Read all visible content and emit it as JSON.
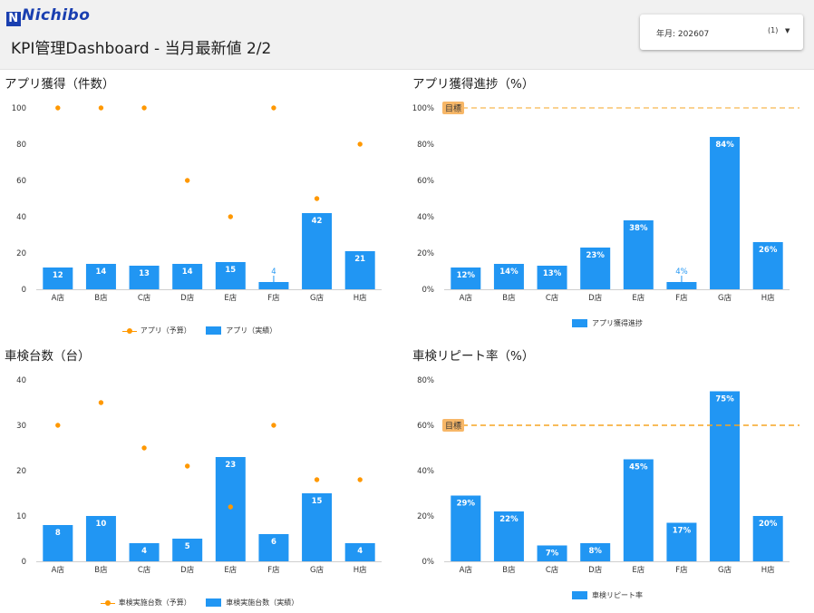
{
  "header": {
    "logo_text": "Nichibo",
    "title": "KPI管理Dashboard - 当月最新値 2/2",
    "filter_label": "年月: 202607",
    "filter_count": "(1)",
    "filter_arrow": "▼"
  },
  "colors": {
    "bar": "#2196f3",
    "budget": "#ff9800",
    "target_line": "#f5a623",
    "target_label_bg": "#f7b768"
  },
  "chart_data": [
    {
      "title": "アプリ獲得（件数）",
      "type": "bar",
      "categories": [
        "A店",
        "B店",
        "C店",
        "D店",
        "E店",
        "F店",
        "G店",
        "H店"
      ],
      "ylim": [
        0,
        100
      ],
      "yticks": [
        "0",
        "20",
        "40",
        "60",
        "80",
        "100"
      ],
      "series": [
        {
          "name": "アプリ（予算）",
          "type": "scatter",
          "values": [
            100,
            100,
            100,
            60,
            40,
            100,
            50,
            80
          ]
        },
        {
          "name": "アプリ（実績）",
          "type": "bar",
          "values": [
            12,
            14,
            13,
            14,
            15,
            4,
            42,
            21
          ],
          "labels": [
            "12",
            "14",
            "13",
            "14",
            "15",
            "4",
            "42",
            "21"
          ]
        }
      ],
      "legend": "bottom"
    },
    {
      "title": "アプリ獲得進捗（%）",
      "type": "bar",
      "categories": [
        "A店",
        "B店",
        "C店",
        "D店",
        "E店",
        "F店",
        "G店",
        "H店"
      ],
      "ylim": [
        0,
        100
      ],
      "yticks": [
        "0%",
        "20%",
        "40%",
        "60%",
        "80%",
        "100%"
      ],
      "series": [
        {
          "name": "アプリ獲得進捗",
          "type": "bar",
          "values": [
            12,
            14,
            13,
            23,
            38,
            4,
            84,
            26
          ],
          "labels": [
            "12%",
            "14%",
            "13%",
            "23%",
            "38%",
            "4%",
            "84%",
            "26%"
          ]
        }
      ],
      "target": {
        "value": 100,
        "label": "目標"
      },
      "legend": "bottom"
    },
    {
      "title": "車検台数（台）",
      "type": "bar",
      "categories": [
        "A店",
        "B店",
        "C店",
        "D店",
        "E店",
        "F店",
        "G店",
        "H店"
      ],
      "ylim": [
        0,
        40
      ],
      "yticks": [
        "0",
        "10",
        "20",
        "30",
        "40"
      ],
      "series": [
        {
          "name": "車検実施台数（予算）",
          "type": "scatter",
          "values": [
            30,
            35,
            25,
            21,
            12,
            30,
            18,
            18
          ]
        },
        {
          "name": "車検実施台数（実績）",
          "type": "bar",
          "values": [
            8,
            10,
            4,
            5,
            23,
            6,
            15,
            4
          ],
          "labels": [
            "8",
            "10",
            "4",
            "5",
            "23",
            "6",
            "15",
            "4"
          ]
        }
      ],
      "legend": "bottom"
    },
    {
      "title": "車検リピート率（%）",
      "type": "bar",
      "categories": [
        "A店",
        "B店",
        "C店",
        "D店",
        "E店",
        "F店",
        "G店",
        "H店"
      ],
      "ylim": [
        0,
        80
      ],
      "yticks": [
        "0%",
        "20%",
        "40%",
        "60%",
        "80%"
      ],
      "series": [
        {
          "name": "車検リピート率",
          "type": "bar",
          "values": [
            29,
            22,
            7,
            8,
            45,
            17,
            75,
            20
          ],
          "labels": [
            "29%",
            "22%",
            "7%",
            "8%",
            "45%",
            "17%",
            "75%",
            "20%"
          ]
        }
      ],
      "target": {
        "value": 60,
        "label": "目標"
      },
      "legend": "bottom"
    }
  ]
}
